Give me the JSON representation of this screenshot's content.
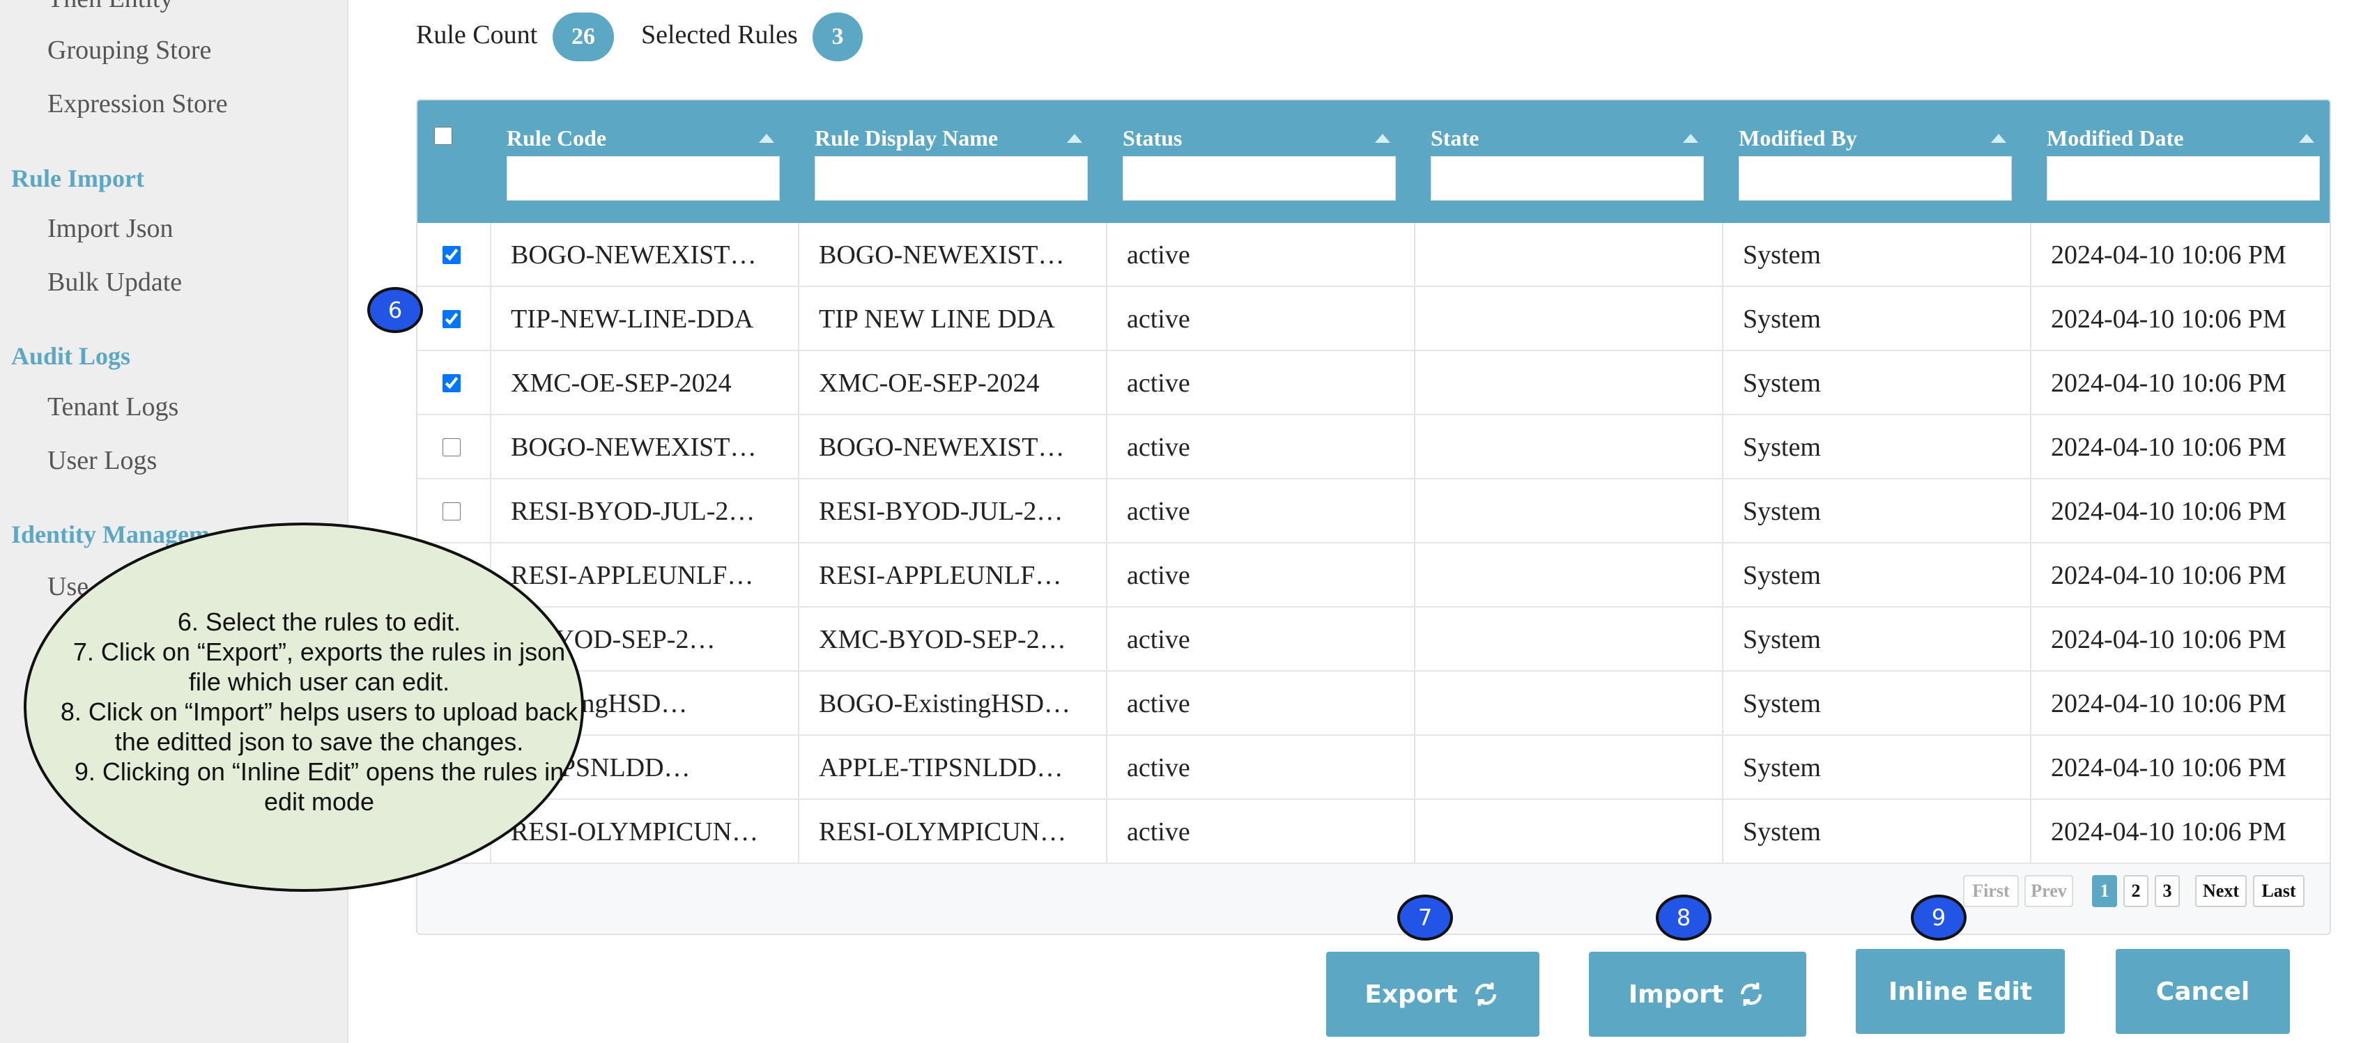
{
  "sidebar": {
    "partial_top_item": "Then Entity",
    "items_top": [
      "Grouping Store",
      "Expression Store"
    ],
    "sections": [
      {
        "title": "Rule Import",
        "items": [
          "Import Json",
          "Bulk Update"
        ]
      },
      {
        "title": "Audit Logs",
        "items": [
          "Tenant Logs",
          "User Logs"
        ]
      },
      {
        "title": "Identity Managem",
        "items": [
          "Use"
        ]
      }
    ]
  },
  "counts": {
    "rule_count_label": "Rule Count",
    "rule_count": "26",
    "selected_label": "Selected Rules",
    "selected": "3"
  },
  "table": {
    "columns": [
      "Rule Code",
      "Rule Display Name",
      "Status",
      "State",
      "Modified By",
      "Modified Date"
    ],
    "rows": [
      {
        "checked": true,
        "code": "BOGO-NEWEXIST…",
        "name": "BOGO-NEWEXIST…",
        "status": "active",
        "state": "",
        "modified_by": "System",
        "date": "2024-04-10 10:06 PM"
      },
      {
        "checked": true,
        "code": "TIP-NEW-LINE-DDA",
        "name": "TIP NEW LINE DDA",
        "status": "active",
        "state": "",
        "modified_by": "System",
        "date": "2024-04-10 10:06 PM"
      },
      {
        "checked": true,
        "code": "XMC-OE-SEP-2024",
        "name": "XMC-OE-SEP-2024",
        "status": "active",
        "state": "",
        "modified_by": "System",
        "date": "2024-04-10 10:06 PM"
      },
      {
        "checked": false,
        "code": "BOGO-NEWEXIST…",
        "name": "BOGO-NEWEXIST…",
        "status": "active",
        "state": "",
        "modified_by": "System",
        "date": "2024-04-10 10:06 PM"
      },
      {
        "checked": false,
        "code": "RESI-BYOD-JUL-2…",
        "name": "RESI-BYOD-JUL-2…",
        "status": "active",
        "state": "",
        "modified_by": "System",
        "date": "2024-04-10 10:06 PM"
      },
      {
        "checked": false,
        "code": "RESI-APPLEUNLF…",
        "name": "RESI-APPLEUNLF…",
        "status": "active",
        "state": "",
        "modified_by": "System",
        "date": "2024-04-10 10:06 PM"
      },
      {
        "checked": false,
        "code": "C-BYOD-SEP-2…",
        "name": "XMC-BYOD-SEP-2…",
        "status": "active",
        "state": "",
        "modified_by": "System",
        "date": "2024-04-10 10:06 PM"
      },
      {
        "checked": false,
        "code": "-ExistingHSD…",
        "name": "BOGO-ExistingHSD…",
        "status": "active",
        "state": "",
        "modified_by": "System",
        "date": "2024-04-10 10:06 PM"
      },
      {
        "checked": false,
        "code": "E-TIPSNLDD…",
        "name": "APPLE-TIPSNLDD…",
        "status": "active",
        "state": "",
        "modified_by": "System",
        "date": "2024-04-10 10:06 PM"
      },
      {
        "checked": false,
        "code": "RESI-OLYMPICUN…",
        "name": "RESI-OLYMPICUN…",
        "status": "active",
        "state": "",
        "modified_by": "System",
        "date": "2024-04-10 10:06 PM"
      }
    ]
  },
  "pagination": {
    "first": "First",
    "prev": "Prev",
    "pages": [
      "1",
      "2",
      "3"
    ],
    "current_page": "1",
    "next": "Next",
    "last": "Last"
  },
  "actions": {
    "export": "Export",
    "import": "Import",
    "inline_edit": "Inline Edit",
    "cancel": "Cancel"
  },
  "markers": {
    "m6": "6",
    "m7": "7",
    "m8": "8",
    "m9": "9"
  },
  "callout": {
    "lines": [
      "6. Select the rules to edit.",
      "7. Click on “Export”, exports the rules in json",
      "file which user can edit.",
      "8. Click on “Import” helps users to upload back",
      "the editted json to save the changes.",
      "9. Clicking on “Inline Edit” opens the rules in",
      "edit mode"
    ]
  },
  "colors": {
    "accent": "#5ba7c4",
    "marker": "#2255e6",
    "callout_bg": "#e4edd8"
  },
  "icons": {
    "refresh": "refresh-icon",
    "sort": "sort-arrow-icon"
  }
}
